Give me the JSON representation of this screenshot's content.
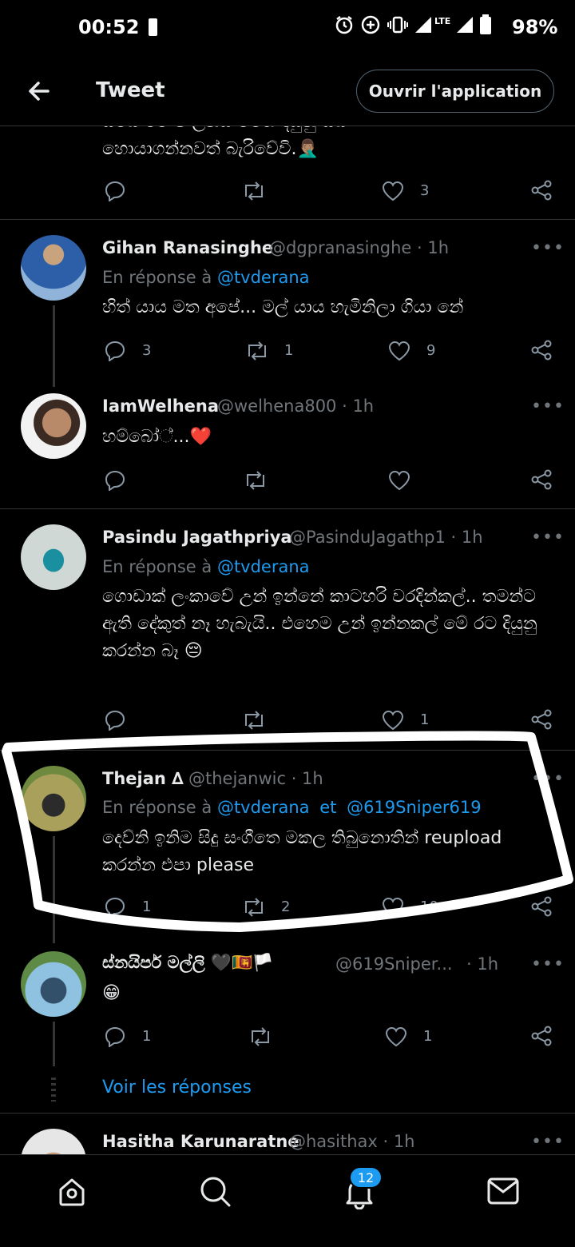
{
  "status_bar": {
    "time": "00:52",
    "battery": "98%",
    "network": "LTE"
  },
  "header": {
    "title": "Tweet",
    "open_app": "Ouvrir l'application"
  },
  "top_fragment": {
    "text": "හොයාගන්නවත් බැරිවේවි.🤦🏽‍♂️",
    "likes": "3"
  },
  "tweets": [
    {
      "name": "Gihan Ranasinghe",
      "handle": "@dgpranasinghe · 1h",
      "reply_prefix": "En réponse à",
      "reply_to": "@tvderana",
      "text": "හිත් යාය මත අපේ... මල් යාය හැමිනිලා ගියා නේ",
      "replies": "3",
      "retweets": "1",
      "likes": "9"
    },
    {
      "name": "IamWelhena",
      "handle": "@welhena800 · 1h",
      "text": "හම්බෝ්...❤️",
      "replies": "",
      "retweets": "",
      "likes": ""
    },
    {
      "name": "Pasindu Jagathpriya",
      "handle": "@PasinduJagathp1 · 1h",
      "reply_prefix": "En réponse à",
      "reply_to": "@tvderana",
      "text": "ගොඩාක් ලංකාවේ උන් ඉන්නේ කාටහරි වරදින්කල්.. තමන්ට ඇති දේකුත් නෑ හැබැයි.. එහෙම උන් ඉන්නකල් මේ රට දියුනු කරන්න බෑ 😔",
      "replies": "",
      "retweets": "",
      "likes": "1"
    },
    {
      "name": "Thejan ∆",
      "handle": "@thejanwic · 1h",
      "reply_prefix": "En réponse à",
      "reply_to": "@tvderana",
      "reply_and": "et",
      "reply_to_2": "@619Sniper619",
      "text": "දෙව්නි ඉනිම සිදු සංගීතෙ මකල තිබුනොතින් reupload කරන්න එපා please",
      "replies": "1",
      "retweets": "2",
      "likes": "10"
    },
    {
      "name": "ස්නයිපර් මල්ලි 🖤🇱🇰🏳️",
      "handle": "@619Sniper...",
      "time": "· 1h",
      "text": "😁",
      "replies": "1",
      "retweets": "",
      "likes": "1"
    },
    {
      "name": "Hasitha Karunaratne",
      "handle": "@hasithax · 1h"
    }
  ],
  "show_replies": "Voir les réponses",
  "nav": {
    "notifications_badge": "12"
  },
  "colors": {
    "background": "#000000",
    "link": "#1d9bf0",
    "muted": "#71767b",
    "separator": "#2f3336"
  }
}
